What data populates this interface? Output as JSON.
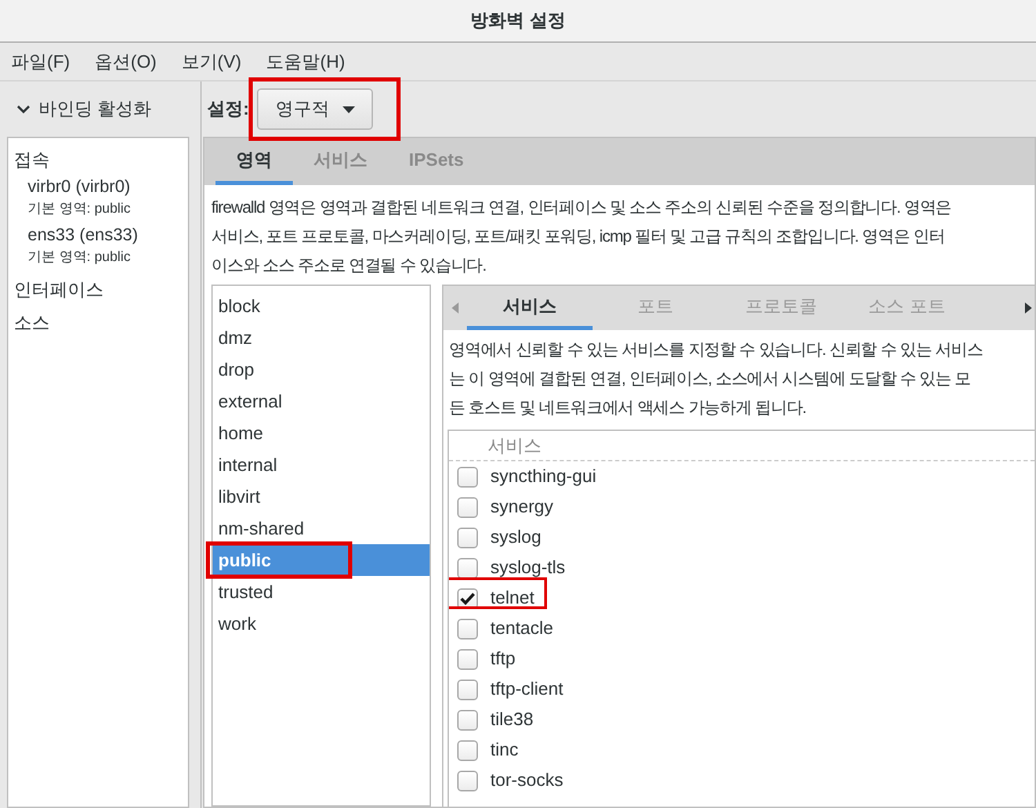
{
  "window": {
    "title": "방화벽 설정"
  },
  "menu": [
    "파일(F)",
    "옵션(O)",
    "보기(V)",
    "도움말(H)"
  ],
  "sidebar": {
    "header": "바인딩 활성화",
    "expanded": true,
    "sections": [
      {
        "label": "접속",
        "items": [
          {
            "name": "virbr0 (virbr0)",
            "detail": "기본 영역: public"
          },
          {
            "name": "ens33 (ens33)",
            "detail": "기본 영역: public"
          }
        ]
      },
      {
        "label": "인터페이스"
      },
      {
        "label": "소스"
      }
    ]
  },
  "config": {
    "label": "설정:",
    "value": "영구적",
    "highlighted": true
  },
  "tabs": [
    {
      "label": "영역",
      "selected": true
    },
    {
      "label": "서비스",
      "selected": false
    },
    {
      "label": "IPSets",
      "selected": false
    }
  ],
  "zone_description": "firewalld 영역은 영역과 결합된 네트워크 연결, 인터페이스 및 소스 주소의 신뢰된 수준을 정의합니다. 영역은\n서비스, 포트 프로토콜, 마스커레이딩, 포트/패킷 포워딩, icmp 필터 및 고급 규칙의 조합입니다. 영역은 인터\n이스와 소스 주소로 연결될 수 있습니다.",
  "zones": [
    {
      "name": "block",
      "selected": false,
      "highlighted": false
    },
    {
      "name": "dmz",
      "selected": false,
      "highlighted": false
    },
    {
      "name": "drop",
      "selected": false,
      "highlighted": false
    },
    {
      "name": "external",
      "selected": false,
      "highlighted": false
    },
    {
      "name": "home",
      "selected": false,
      "highlighted": false
    },
    {
      "name": "internal",
      "selected": false,
      "highlighted": false
    },
    {
      "name": "libvirt",
      "selected": false,
      "highlighted": false
    },
    {
      "name": "nm-shared",
      "selected": false,
      "highlighted": false
    },
    {
      "name": "public",
      "selected": true,
      "highlighted": true
    },
    {
      "name": "trusted",
      "selected": false,
      "highlighted": false
    },
    {
      "name": "work",
      "selected": false,
      "highlighted": false
    }
  ],
  "zone_tabs": [
    {
      "label": "서비스",
      "selected": true
    },
    {
      "label": "포트",
      "selected": false
    },
    {
      "label": "프로토콜",
      "selected": false
    },
    {
      "label": "소스 포트",
      "selected": false
    }
  ],
  "services_description": "영역에서 신뢰할 수 있는 서비스를 지정할 수 있습니다. 신뢰할 수 있는 서비스\n는 이 영역에 결합된 연결, 인터페이스, 소스에서 시스템에 도달할 수 있는 모\n든 호스트 및 네트워크에서 액세스 가능하게 됩니다.",
  "services_table": {
    "columns": [
      "서비스"
    ],
    "rows": [
      {
        "name": "syncthing-gui",
        "checked": false,
        "highlighted": false
      },
      {
        "name": "synergy",
        "checked": false,
        "highlighted": false
      },
      {
        "name": "syslog",
        "checked": false,
        "highlighted": false
      },
      {
        "name": "syslog-tls",
        "checked": false,
        "highlighted": false
      },
      {
        "name": "telnet",
        "checked": true,
        "highlighted": true
      },
      {
        "name": "tentacle",
        "checked": false,
        "highlighted": false
      },
      {
        "name": "tftp",
        "checked": false,
        "highlighted": false
      },
      {
        "name": "tftp-client",
        "checked": false,
        "highlighted": false
      },
      {
        "name": "tile38",
        "checked": false,
        "highlighted": false
      },
      {
        "name": "tinc",
        "checked": false,
        "highlighted": false
      },
      {
        "name": "tor-socks",
        "checked": false,
        "highlighted": false
      }
    ]
  }
}
